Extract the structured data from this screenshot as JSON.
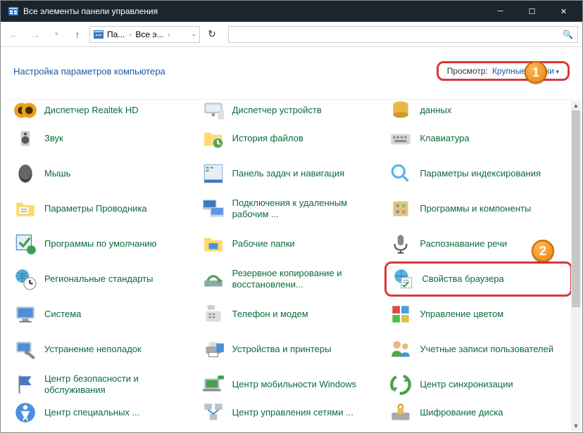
{
  "window": {
    "title": "Все элементы панели управления"
  },
  "breadcrumb": {
    "c1": "Па...",
    "c2": "Все э..."
  },
  "header": {
    "title": "Настройка параметров компьютера",
    "viewby_label": "Просмотр:",
    "viewby_value": "Крупные значки"
  },
  "badges": {
    "b1": "1",
    "b2": "2"
  },
  "items": {
    "r0c0": "Диспетчер Realtek HD",
    "r0c1": "Диспетчер устройств",
    "r0c2": "данных",
    "r1c0": "Звук",
    "r1c1": "История файлов",
    "r1c2": "Клавиатура",
    "r2c0": "Мышь",
    "r2c1": "Панель задач и навигация",
    "r2c2": "Параметры индексирования",
    "r3c0": "Параметры Проводника",
    "r3c1": "Подключения к удаленным рабочим ...",
    "r3c2": "Программы и компоненты",
    "r4c0": "Программы по умолчанию",
    "r4c1": "Рабочие папки",
    "r4c2": "Распознавание речи",
    "r5c0": "Региональные стандарты",
    "r5c1": "Резервное копирование и восстановлени...",
    "r5c2": "Свойства браузера",
    "r6c0": "Система",
    "r6c1": "Телефон и модем",
    "r6c2": "Управление цветом",
    "r7c0": "Устранение неполадок",
    "r7c1": "Устройства и принтеры",
    "r7c2": "Учетные записи пользователей",
    "r8c0": "Центр безопасности и обслуживания",
    "r8c1": "Центр мобильности Windows",
    "r8c2": "Центр синхронизации",
    "r9c0": "Центр специальных ...",
    "r9c1": "Центр управления сетями ...",
    "r9c2": "Шифрование диска"
  }
}
